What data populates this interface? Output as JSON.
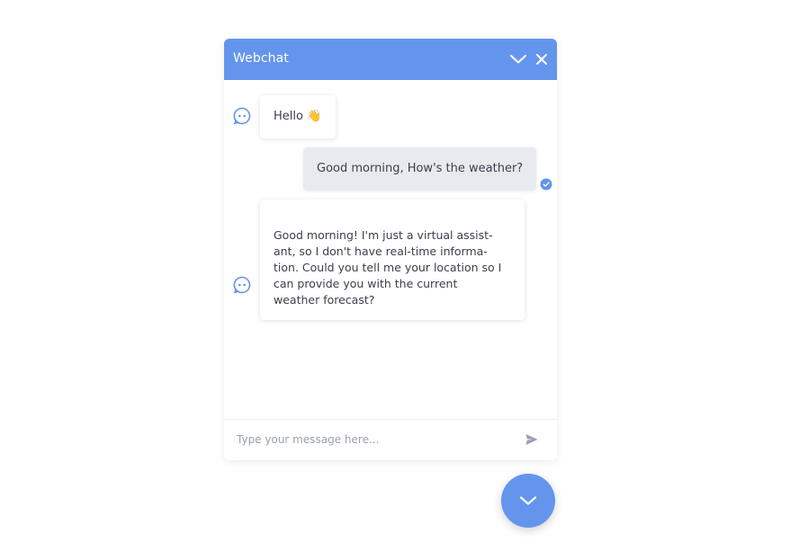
{
  "header": {
    "title": "Webchat",
    "minimize_icon": "chevron-down-icon",
    "close_icon": "close-icon"
  },
  "messages": [
    {
      "sender": "bot",
      "text": "Hello 👋"
    },
    {
      "sender": "user",
      "text": "Good morning, How's the weather?",
      "status": "delivered"
    },
    {
      "sender": "bot",
      "text": "Good morning! I'm just a virtual assist-\nant, so I don't have real-time informa-\ntion. Could you tell me your location so I\ncan provide you with the current\nweather forecast?"
    }
  ],
  "composer": {
    "placeholder": "Type your message here...",
    "value": "",
    "send_icon": "send-icon"
  },
  "launcher": {
    "icon": "chevron-down-icon"
  },
  "colors": {
    "accent": "#6495ed",
    "user_bubble": "#e8eaf0",
    "text": "#3a3f4a"
  }
}
